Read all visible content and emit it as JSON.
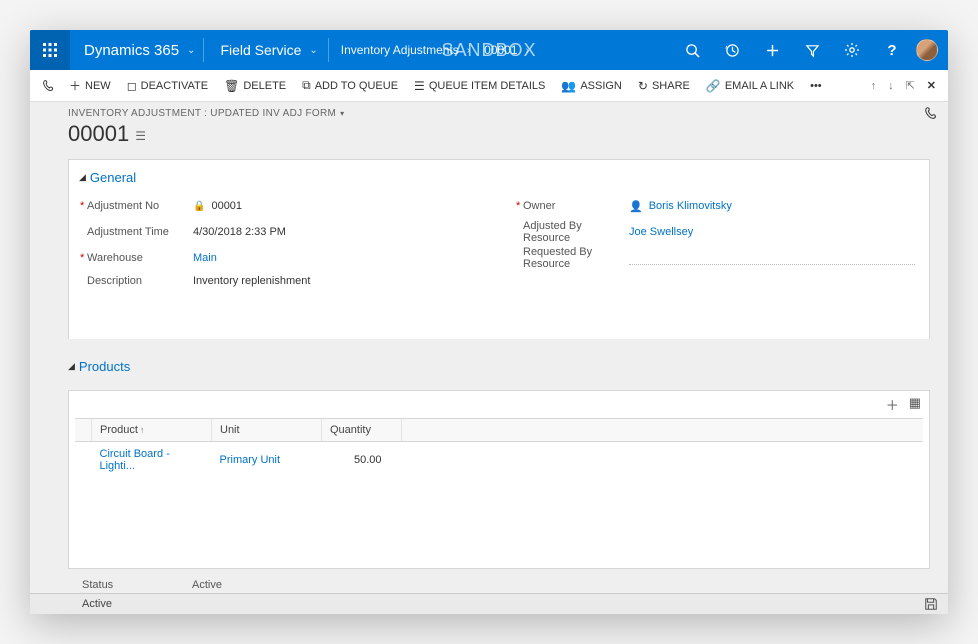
{
  "nav": {
    "brand": "Dynamics 365",
    "area": "Field Service",
    "crumb_entity": "Inventory Adjustments",
    "crumb_record": "00001",
    "environment_tag": "SANDBOX"
  },
  "commands": {
    "new": "NEW",
    "deactivate": "DEACTIVATE",
    "delete": "DELETE",
    "add_to_queue": "ADD TO QUEUE",
    "queue_item_details": "QUEUE ITEM DETAILS",
    "assign": "ASSIGN",
    "share": "SHARE",
    "email_link": "EMAIL A LINK",
    "more": "•••"
  },
  "form": {
    "form_caption": "INVENTORY ADJUSTMENT : UPDATED INV ADJ FORM",
    "record_title": "00001"
  },
  "sections": {
    "general": "General",
    "products": "Products"
  },
  "fields": {
    "adjustment_no": {
      "label": "Adjustment No",
      "value": "00001"
    },
    "adjustment_time": {
      "label": "Adjustment Time",
      "value": "4/30/2018  2:33 PM"
    },
    "warehouse": {
      "label": "Warehouse",
      "value": "Main"
    },
    "description": {
      "label": "Description",
      "value": "Inventory replenishment"
    },
    "owner": {
      "label": "Owner",
      "value": "Boris Klimovitsky"
    },
    "adjusted_by": {
      "label": "Adjusted By Resource",
      "value": "Joe Swellsey"
    },
    "requested_by": {
      "label": "Requested By Resource",
      "value": ""
    }
  },
  "grid": {
    "columns": {
      "product": "Product",
      "unit": "Unit",
      "quantity": "Quantity"
    },
    "rows": [
      {
        "product": "Circuit Board - Lighti...",
        "unit": "Primary Unit",
        "quantity": "50.00"
      }
    ]
  },
  "status": {
    "label": "Status",
    "value": "Active",
    "footer_state": "Active"
  }
}
